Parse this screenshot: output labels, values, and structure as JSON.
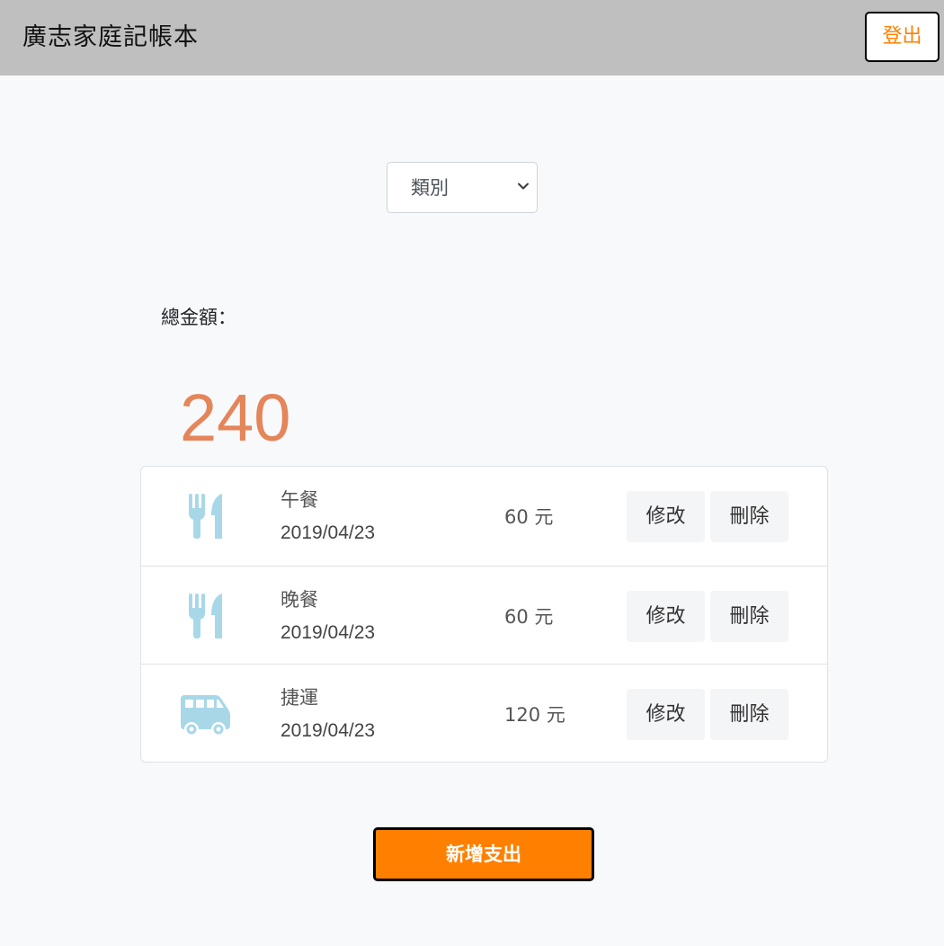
{
  "navbar": {
    "brand": "廣志家庭記帳本",
    "logout_label": "登出"
  },
  "filter": {
    "selected": "類別"
  },
  "total": {
    "label": "總金額：",
    "amount": "240"
  },
  "records": [
    {
      "icon": "utensils-icon",
      "name": "午餐",
      "date": "2019/04/23",
      "amount": "60 元",
      "edit_label": "修改",
      "delete_label": "刪除"
    },
    {
      "icon": "utensils-icon",
      "name": "晚餐",
      "date": "2019/04/23",
      "amount": "60 元",
      "edit_label": "修改",
      "delete_label": "刪除"
    },
    {
      "icon": "shuttle-van-icon",
      "name": "捷運",
      "date": "2019/04/23",
      "amount": "120 元",
      "edit_label": "修改",
      "delete_label": "刪除"
    }
  ],
  "add_button_label": "新增支出",
  "colors": {
    "accent_orange": "#ff8000",
    "total_amount": "#e4855a",
    "icon_blue": "#a8d8e8",
    "navbar_bg": "#bfbfbf"
  }
}
